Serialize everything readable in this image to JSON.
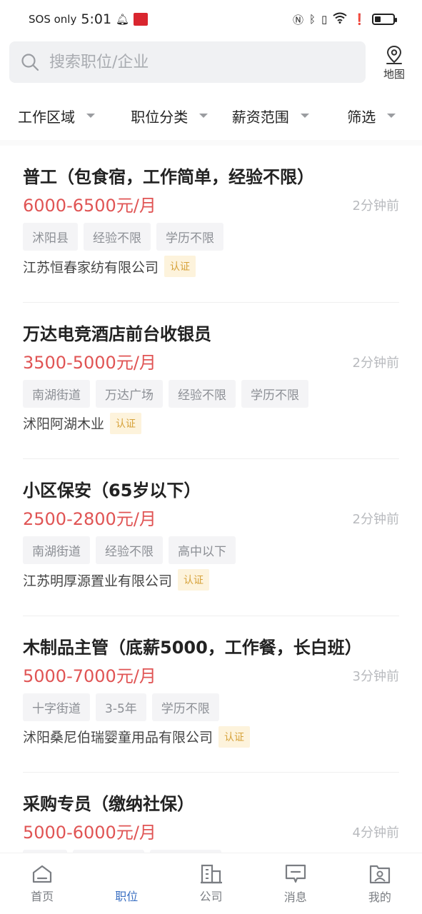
{
  "status_bar": {
    "carrier": "SOS only",
    "time": "5:01",
    "battery_level": 0.35
  },
  "search": {
    "placeholder": "搜索职位/企业",
    "map_label": "地图"
  },
  "filters": [
    {
      "label": "工作区域"
    },
    {
      "label": "职位分类"
    },
    {
      "label": "薪资范围"
    },
    {
      "label": "筛选"
    }
  ],
  "jobs": [
    {
      "title": "普工（包食宿，工作简单，经验不限）",
      "salary": "6000-6500元/月",
      "time": "2分钟前",
      "tags": [
        "沭阳县",
        "经验不限",
        "学历不限"
      ],
      "company": "江苏恒春家纺有限公司",
      "badge": "认证"
    },
    {
      "title": "万达电竞酒店前台收银员",
      "salary": "3500-5000元/月",
      "time": "2分钟前",
      "tags": [
        "南湖街道",
        "万达广场",
        "经验不限",
        "学历不限"
      ],
      "company": "沭阳阿湖木业",
      "badge": "认证"
    },
    {
      "title": "小区保安（65岁以下）",
      "salary": "2500-2800元/月",
      "time": "2分钟前",
      "tags": [
        "南湖街道",
        "经验不限",
        "高中以下"
      ],
      "company": "江苏明厚源置业有限公司",
      "badge": "认证"
    },
    {
      "title": "木制品主管（底薪5000，工作餐，长白班）",
      "salary": "5000-7000元/月",
      "time": "3分钟前",
      "tags": [
        "十字街道",
        "3-5年",
        "学历不限"
      ],
      "company": "沭阳桑尼伯瑞婴童用品有限公司",
      "badge": "认证"
    },
    {
      "title": "采购专员（缴纳社保）",
      "salary": "5000-6000元/月",
      "time": "4分钟前",
      "tags": [],
      "company": "",
      "badge": ""
    }
  ],
  "nav": [
    {
      "label": "首页",
      "icon": "home-icon",
      "active": false
    },
    {
      "label": "职位",
      "icon": "briefcase-icon",
      "active": true
    },
    {
      "label": "公司",
      "icon": "building-icon",
      "active": false
    },
    {
      "label": "消息",
      "icon": "message-icon",
      "active": false
    },
    {
      "label": "我的",
      "icon": "profile-icon",
      "active": false
    }
  ],
  "colors": {
    "salary": "#e05454",
    "active_nav": "#3a6fc2",
    "badge_bg": "#fdf3dc",
    "badge_text": "#d6a23a"
  }
}
